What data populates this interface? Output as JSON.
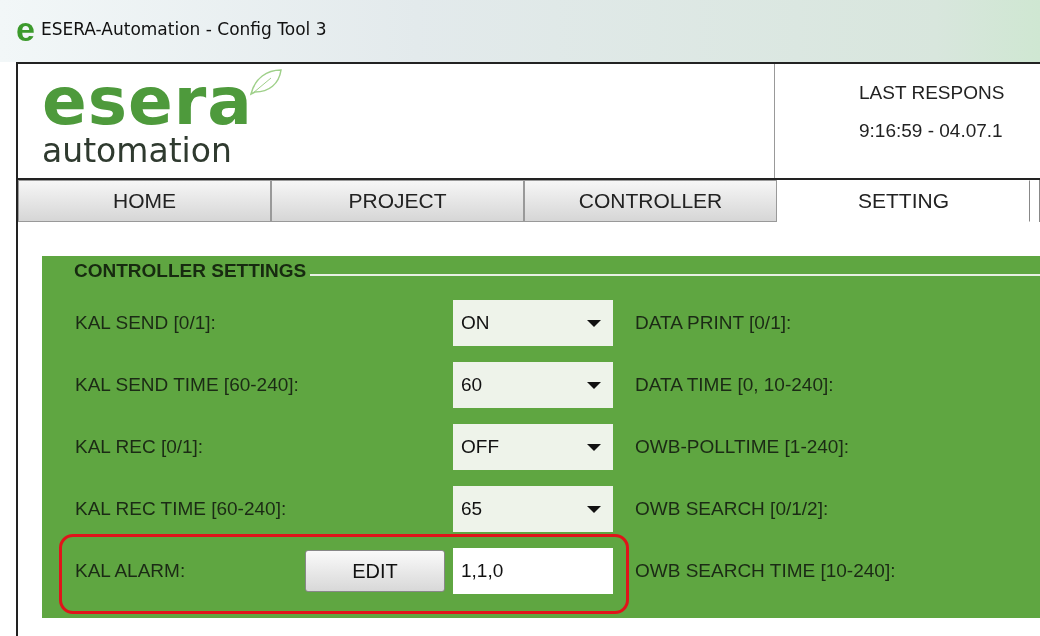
{
  "window": {
    "icon_letter": "e",
    "title": "ESERA-Automation - Config Tool 3"
  },
  "header": {
    "logo": {
      "word": "esera",
      "tagline": "automation"
    },
    "last_response_label": "LAST RESPONS",
    "last_response_time": "9:16:59 - 04.07.1"
  },
  "tabs": [
    {
      "label": "HOME",
      "selected": false
    },
    {
      "label": "PROJECT",
      "selected": false
    },
    {
      "label": "CONTROLLER",
      "selected": false
    },
    {
      "label": "SETTING",
      "selected": true
    }
  ],
  "panel": {
    "title": "CONTROLLER SETTINGS",
    "rows": [
      {
        "label": "KAL SEND [0/1]:",
        "kind": "select",
        "value": "ON",
        "right_label": "DATA PRINT [0/1]:",
        "highlighted": false
      },
      {
        "label": "KAL SEND TIME [60-240]:",
        "kind": "select",
        "value": "60",
        "right_label": "DATA TIME [0, 10-240]:",
        "highlighted": false
      },
      {
        "label": "KAL REC [0/1]:",
        "kind": "select",
        "value": "OFF",
        "right_label": "OWB-POLLTIME [1-240]:",
        "highlighted": false
      },
      {
        "label": "KAL REC TIME [60-240]:",
        "kind": "select",
        "value": "65",
        "right_label": "OWB SEARCH [0/1/2]:",
        "highlighted": false
      },
      {
        "label": "KAL ALARM:",
        "kind": "edit",
        "button": "EDIT",
        "value": "1,1,0",
        "right_label": "OWB SEARCH TIME [10-240]:",
        "highlighted": true
      }
    ]
  }
}
